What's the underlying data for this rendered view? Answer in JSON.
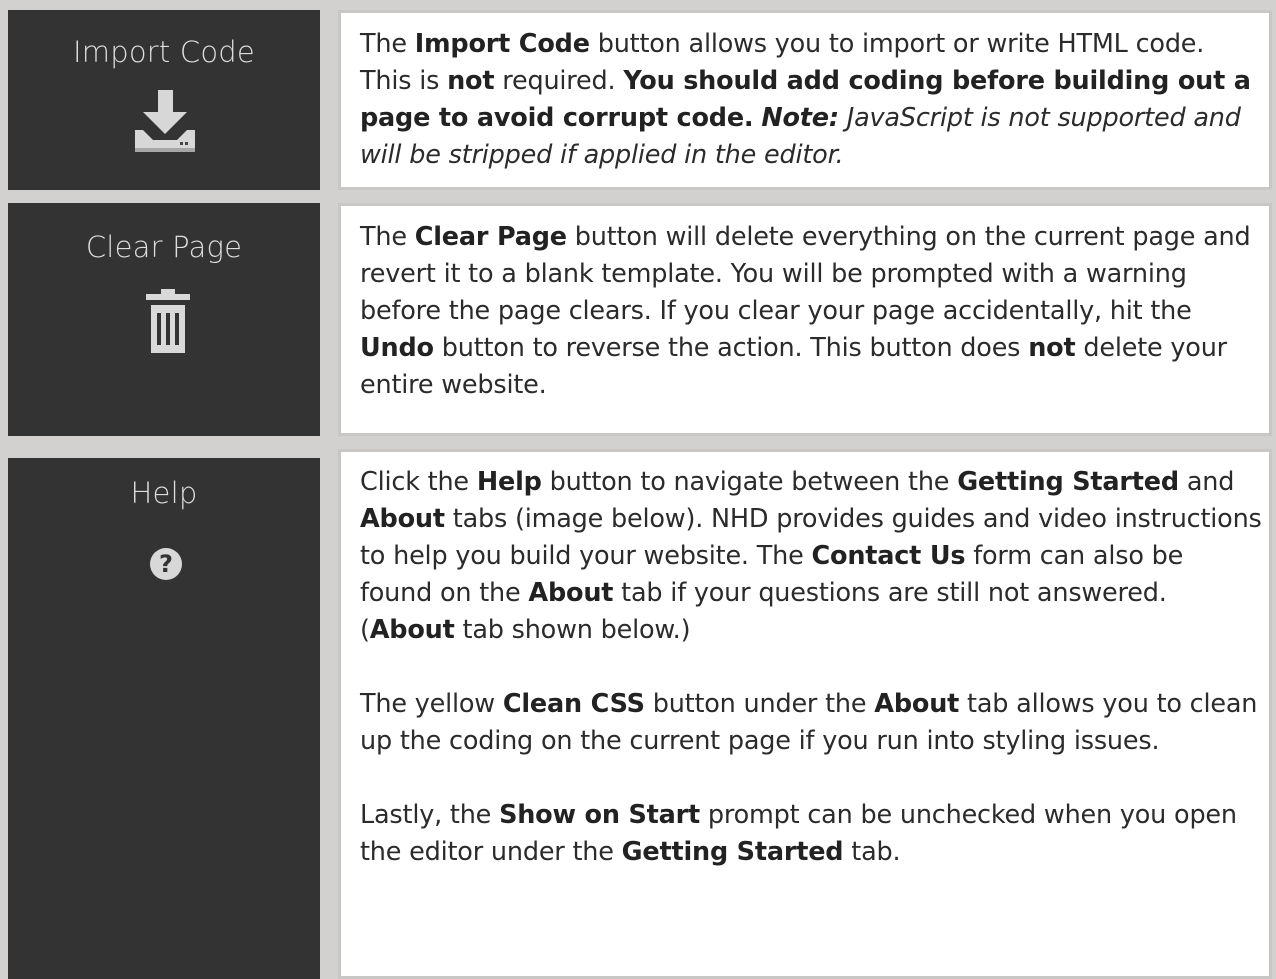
{
  "rows": [
    {
      "button_label": "Import Code",
      "icon": "download-icon",
      "text": {
        "s1": "The ",
        "s2": "Import Code",
        "s3": " button allows you to import or write HTML code. This is ",
        "s4": "not",
        "s5": " required. ",
        "s6": "You should add coding before building out a page to avoid corrupt code.",
        "s7": " ",
        "s8": "Note:",
        "s9": " JavaScript is not supported and will be stripped if applied in the editor."
      }
    },
    {
      "button_label": "Clear Page",
      "icon": "trash-icon",
      "text": {
        "s1": "The ",
        "s2": "Clear Page",
        "s3": " button will delete everything on the current page and revert it to a blank template. You will be prompted with a warning before the page clears. If you clear your page accidentally, hit the ",
        "s4": "Undo",
        "s5": " button to reverse the action. This button does ",
        "s6": "not",
        "s7": " delete your entire website."
      }
    },
    {
      "button_label": "Help",
      "icon": "help-icon",
      "help_icon_glyph": "?",
      "text": {
        "p1": {
          "s1": "Click the ",
          "s2": "Help",
          "s3": " button to navigate between the ",
          "s4": "Getting Started",
          "s5": " and ",
          "s6": "About",
          "s7": " tabs (image below). NHD provides guides and video instructions to help you build your website. The ",
          "s8": "Contact Us",
          "s9": " form can also be found on the ",
          "s10": "About",
          "s11": " tab if your questions are still not answered. (",
          "s12": "About",
          "s13": " tab shown below.)"
        },
        "p2": {
          "s1": "The yellow ",
          "s2": "Clean CSS",
          "s3": " button under the ",
          "s4": "About",
          "s5": " tab allows you to clean up the coding on the current page if you run into styling issues."
        },
        "p3": {
          "s1": "Lastly, the ",
          "s2": "Show on Start",
          "s3": " prompt can be unchecked when you open the editor under the ",
          "s4": "Getting Started",
          "s5": " tab."
        }
      }
    }
  ]
}
